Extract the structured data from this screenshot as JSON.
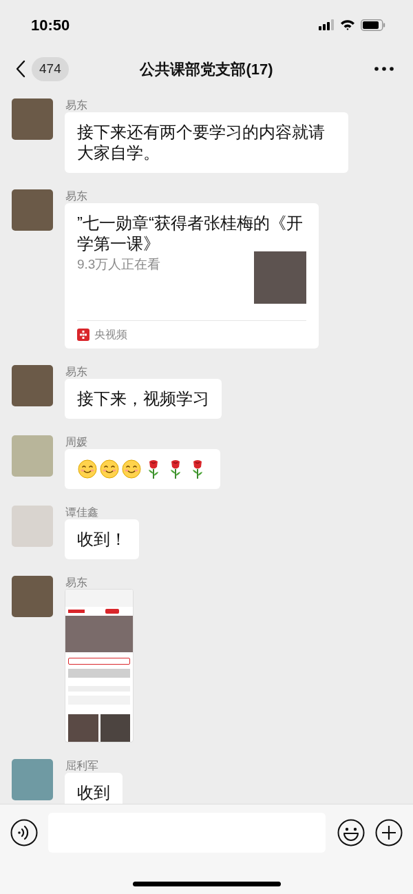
{
  "status_bar": {
    "time": "10:50"
  },
  "nav": {
    "unread_count": "474",
    "title": "公共课部党支部(17)"
  },
  "messages": [
    {
      "kind": "text",
      "sender": "易东",
      "text": "接下来还有两个要学习的内容就请大家自学。"
    },
    {
      "kind": "link",
      "sender": "易东",
      "title": "”七一勋章“获得者张桂梅的《开学第一课》",
      "subtitle": "9.3万人正在看",
      "source": "央视频"
    },
    {
      "kind": "text",
      "sender": "易东",
      "text": "接下来，视频学习"
    },
    {
      "kind": "emoji",
      "sender": "周媛",
      "emojis": [
        {
          "kind": "smile"
        },
        {
          "kind": "smile"
        },
        {
          "kind": "smile"
        },
        {
          "kind": "rose"
        },
        {
          "kind": "rose"
        },
        {
          "kind": "rose"
        }
      ]
    },
    {
      "kind": "text",
      "sender": "谭佳鑫",
      "text": "收到！"
    },
    {
      "kind": "image",
      "sender": "易东"
    },
    {
      "kind": "text",
      "sender": "屈利军",
      "text": "收到"
    }
  ]
}
